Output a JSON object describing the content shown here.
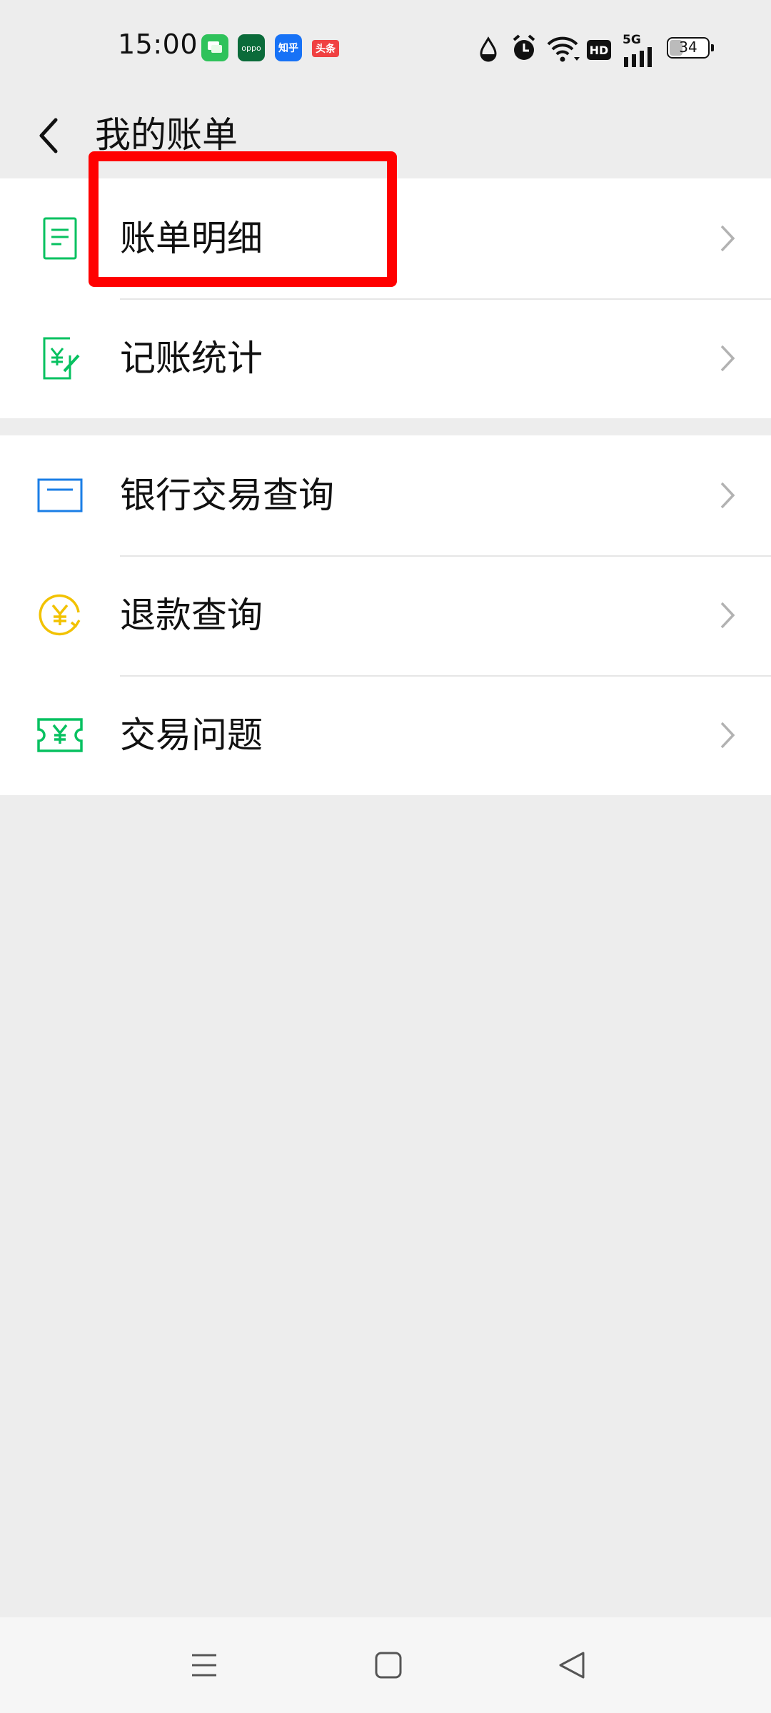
{
  "status_bar": {
    "time": "15:00",
    "notification_apps": [
      {
        "name": "messages-app-icon",
        "label": "",
        "color": "#2fc25b"
      },
      {
        "name": "oppo-app-icon",
        "label": "oppo",
        "color": "#0b6b3a"
      },
      {
        "name": "zhihu-app-icon",
        "label": "知乎",
        "color": "#1772f6"
      },
      {
        "name": "toutiao-app-icon",
        "label": "头条",
        "color": "#f04142"
      }
    ],
    "network": "5G",
    "hd_badge": "HD",
    "battery_level": "34"
  },
  "header": {
    "title": "我的账单",
    "back_icon": "chevron-left-icon"
  },
  "groups": [
    {
      "items": [
        {
          "label": "账单明细",
          "icon": "bill-document-icon",
          "icon_color": "#07c160"
        },
        {
          "label": "记账统计",
          "icon": "ledger-stat-icon",
          "icon_color": "#07c160"
        }
      ]
    },
    {
      "items": [
        {
          "label": "银行交易查询",
          "icon": "bank-card-icon",
          "icon_color": "#1a7ee6"
        },
        {
          "label": "退款查询",
          "icon": "refund-yen-icon",
          "icon_color": "#f2c200"
        },
        {
          "label": "交易问题",
          "icon": "ticket-yen-icon",
          "icon_color": "#07c160"
        }
      ]
    }
  ],
  "highlight_target": "账单明细",
  "nav_bar": {
    "menu_icon": "menu-icon",
    "home_icon": "home-square-icon",
    "back_icon": "back-triangle-icon"
  },
  "colors": {
    "background": "#ededed",
    "surface": "#ffffff",
    "highlight": "#ff0000",
    "chevron": "#b2b2b2"
  }
}
